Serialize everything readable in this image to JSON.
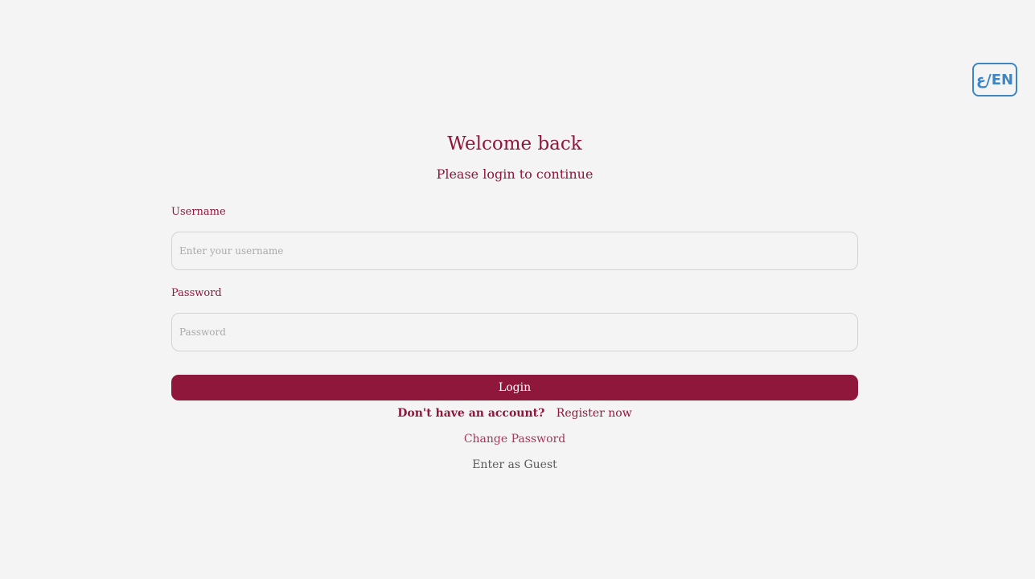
{
  "language_toggle": {
    "label": "ع/EN"
  },
  "header": {
    "title": "Welcome back",
    "subtitle": "Please login to continue"
  },
  "form": {
    "username": {
      "label": "Username",
      "placeholder": "Enter your username",
      "value": ""
    },
    "password": {
      "label": "Password",
      "placeholder": "Password",
      "value": ""
    },
    "login_label": "Login"
  },
  "links": {
    "no_account_text": "Don't have an account?",
    "register_label": "Register now",
    "change_password_label": "Change Password",
    "guest_label": "Enter as Guest"
  },
  "colors": {
    "primary": "#8e173b",
    "accent_blue": "#3d86c6",
    "background": "#f4f4f4"
  }
}
